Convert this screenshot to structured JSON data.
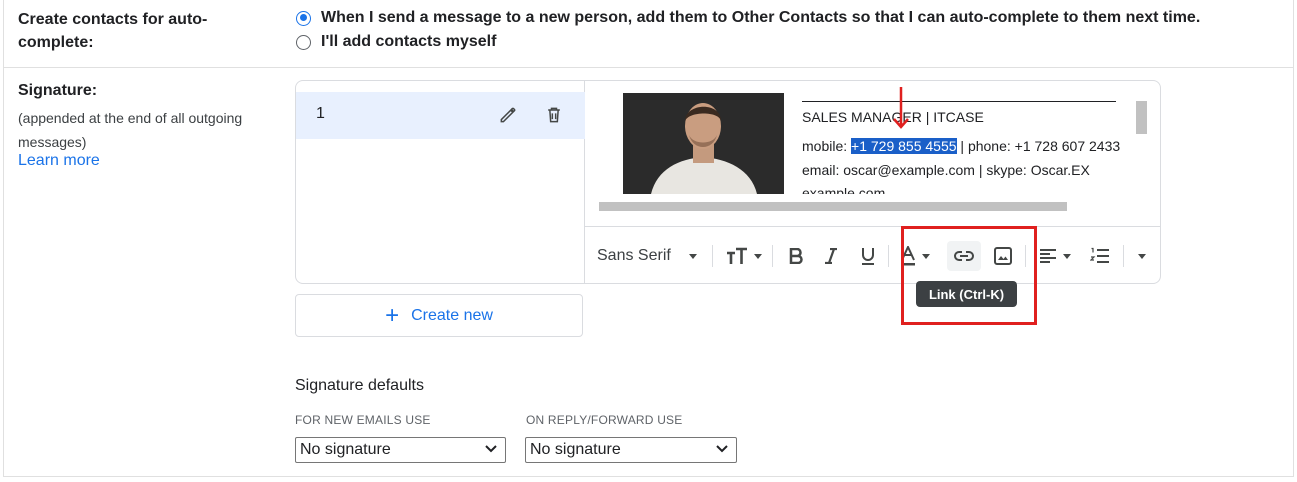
{
  "contacts": {
    "label_line1": "Create contacts for auto-",
    "label_line2": "complete:",
    "option_auto": "When I send a message to a new person, add them to Other Contacts so that I can auto-complete to them next time.",
    "option_manual": "I'll add contacts myself",
    "selected": "auto"
  },
  "signature": {
    "title": "Signature:",
    "subtitle": "(appended at the end of all outgoing messages)",
    "learn_more": "Learn more",
    "items": [
      {
        "name": "1"
      }
    ],
    "content": {
      "title_line": "SALES MANAGER |  ITCASE",
      "mobile_label": "mobile: ",
      "mobile_value": "+1 729 855 4555",
      "phone_part": " | phone: +1 728 607 2433",
      "email_line": "email: oscar@example.com | skype: Oscar.EX",
      "site_line": "example.com"
    },
    "toolbar": {
      "font": "Sans Serif",
      "tooltip": "Link (Ctrl-K)"
    },
    "create_new": "Create new"
  },
  "defaults": {
    "title": "Signature defaults",
    "new_label": "FOR NEW EMAILS USE",
    "reply_label": "ON REPLY/FORWARD USE",
    "new_value": "No signature",
    "reply_value": "No signature"
  },
  "annotation": {
    "color": "#e0201f"
  }
}
